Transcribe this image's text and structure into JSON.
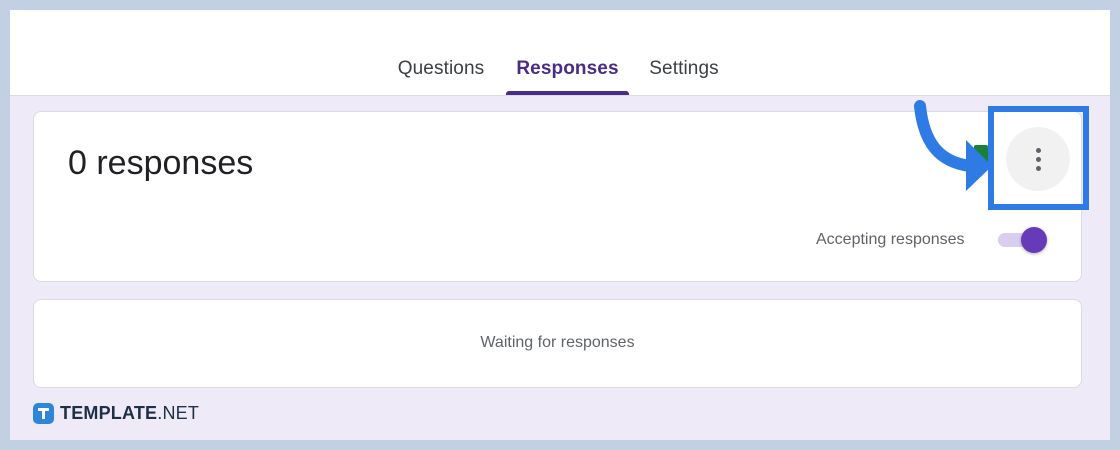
{
  "tabs": {
    "questions": "Questions",
    "responses": "Responses",
    "settings": "Settings",
    "active": "responses"
  },
  "summary": {
    "count_label": "0 responses",
    "more_options_icon": "more-vert-icon",
    "accepting_label": "Accepting responses",
    "accepting_enabled": true
  },
  "waiting": {
    "message": "Waiting for responses"
  },
  "annotation": {
    "arrow_icon": "curved-arrow-icon",
    "color": "#2f7be5"
  },
  "brand": {
    "name_bold": "TEMPLATE",
    "name_rest": ".NET",
    "logo_icon": "template-logo-icon"
  },
  "colors": {
    "accent": "#673ab7",
    "tab_active": "#4a2c86",
    "sheets_green": "#188038",
    "background": "#efeaf7"
  }
}
